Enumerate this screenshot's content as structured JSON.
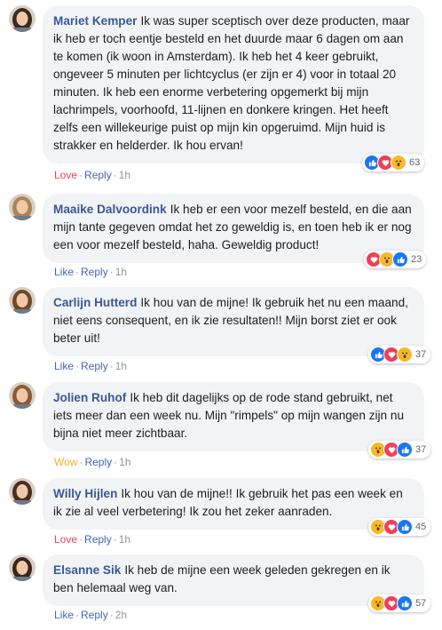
{
  "comments": [
    {
      "author": "Mariet Kemper",
      "text": "Ik was super sceptisch over deze producten, maar ik heb er toch eentje besteld en het duurde maar 6 dagen om aan te komen (ik woon in Amsterdam). Ik heb het 4 keer gebruikt, ongeveer 5 minuten per lichtcyclus (er zijn er 4) voor in totaal 20 minuten. Ik heb een enorme verbetering opgemerkt bij mijn lachrimpels, voorhoofd, 11-lijnen en donkere kringen. Het heeft zelfs een willekeurige puist op mijn kin opgeruimd. Mijn huid is strakker en helderder. Ik hou ervan!",
      "reaction_label": "Love",
      "reaction_kind": "love",
      "reply_label": "Reply",
      "time": "1h",
      "reaction_icons": [
        "like",
        "love",
        "wow"
      ],
      "reaction_count": "63",
      "avatar_hair": "#3a2a1e"
    },
    {
      "author": "Maaike Dalvoordink",
      "text": "Ik heb er een voor mezelf besteld, en die aan mijn tante gegeven omdat het zo geweldig is, en toen heb ik er nog een voor mezelf besteld, haha. Geweldig product!",
      "reaction_label": "Like",
      "reaction_kind": "like",
      "reply_label": "Reply",
      "time": "1h",
      "reaction_icons": [
        "love",
        "wow",
        "like"
      ],
      "reaction_count": "23",
      "avatar_hair": "#a88457"
    },
    {
      "author": "Carlijn Hutterd",
      "text": "Ik hou van de mijne! Ik gebruik het nu een maand, niet eens consequent, en ik zie resultaten!! Mijn borst ziet er ook beter uit!",
      "reaction_label": "Like",
      "reaction_kind": "like",
      "reply_label": "Reply",
      "time": "1h",
      "reaction_icons": [
        "like",
        "love",
        "wow"
      ],
      "reaction_count": "37",
      "avatar_hair": "#6b4a2b"
    },
    {
      "author": "Jolien Ruhof",
      "text": "Ik heb dit dagelijks op de rode stand gebruikt, net iets meer dan een week nu. Mijn \"rimpels\" op mijn wangen zijn nu bijna niet meer zichtbaar.",
      "reaction_label": "Wow",
      "reaction_kind": "wow",
      "reply_label": "Reply",
      "time": "1h",
      "reaction_icons": [
        "wow",
        "love",
        "like"
      ],
      "reaction_count": "37",
      "avatar_hair": "#8a5a34"
    },
    {
      "author": "Willy Hijlen",
      "text": "Ik hou van de mijne!! Ik gebruik het pas een week en ik zie al veel verbetering! Ik zou het zeker aanraden.",
      "reaction_label": "Love",
      "reaction_kind": "love",
      "reply_label": "Reply",
      "time": "1h",
      "reaction_icons": [
        "wow",
        "love",
        "like"
      ],
      "reaction_count": "45",
      "avatar_hair": "#4a2e22"
    },
    {
      "author": "Elsanne Sik",
      "text": "Ik heb de mijne een week geleden gekregen en ik ben helemaal weg van.",
      "reaction_label": "Like",
      "reaction_kind": "like",
      "reply_label": "Reply",
      "time": "2h",
      "reaction_icons": [
        "wow",
        "love",
        "like"
      ],
      "reaction_count": "57",
      "avatar_hair": "#3b2418"
    }
  ],
  "separator": "·",
  "colors": {
    "author": "#385898",
    "like": "#4267b2",
    "love": "#f33e58",
    "wow": "#f7b125",
    "bubble": "#f2f3f5"
  }
}
